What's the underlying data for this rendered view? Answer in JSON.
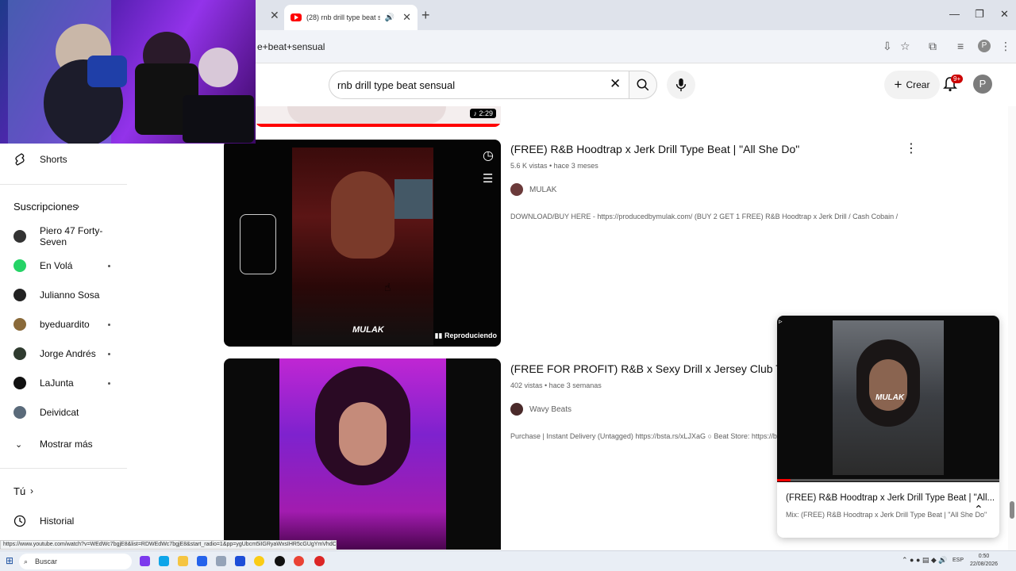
{
  "browser": {
    "active_tab_title": "(28) rnb drill type beat sensual - YouTube",
    "url": "e+beat+sensual",
    "status_url": "https://www.youtube.com/watch?v=WEdWc7bgjE8&list=RDWEdWc7bgjE8&start_radio=1&pp=ygUbcm5iIGRyaWxsIHR5cGUgYmVhdCBzZW5zdWFs",
    "profile_initial": "P"
  },
  "header": {
    "search_value": "rnb drill type beat sensual",
    "create_label": "Crear",
    "notifications_badge": "9+",
    "avatar_initial": "P"
  },
  "sidebar": {
    "shorts_label": "Shorts",
    "subscriptions_heading": "Suscripciones",
    "subscriptions": [
      {
        "label": "Piero 47 Forty-Seven",
        "color": "#333333",
        "dot": false
      },
      {
        "label": "En Volá",
        "color": "#25d366",
        "dot": true
      },
      {
        "label": "Julianno Sosa",
        "color": "#222222",
        "dot": false
      },
      {
        "label": "byeduardito",
        "color": "#8a6a3a",
        "dot": true
      },
      {
        "label": "Jorge Andrés",
        "color": "#2f3b2f",
        "dot": true
      },
      {
        "label": "LaJunta",
        "color": "#111111",
        "dot": true
      },
      {
        "label": "Deividcat",
        "color": "#5a6a7a",
        "dot": false
      }
    ],
    "show_more_label": "Mostrar más",
    "you_heading": "Tú",
    "history_label": "Historial"
  },
  "results": {
    "prev_duration": "2:29",
    "items": [
      {
        "title": "(FREE) R&B Hoodtrap x Jerk Drill Type Beat | \"All She Do\"",
        "meta": "5.6 K vistas • hace 3 meses",
        "channel": "MULAK",
        "description": "DOWNLOAD/BUY HERE - https://producedbymulak.com/ (BUY 2 GET 1 FREE) R&B Hoodtrap x Jerk Drill / Cash Cobain / Central ...",
        "thumb_watermark": "MULAK",
        "thumb_status": "Reproduciendo"
      },
      {
        "title": "(FREE FOR PROFIT) R&B x Sexy Drill x Jersey Club Type Beat",
        "meta": "402 vistas • hace 3 semanas",
        "channel": "Wavy Beats",
        "description": "Purchase | Instant Delivery (Untagged) https://bsta.rs/xLJXaG ○ Beat Store: https://beatstars"
      }
    ]
  },
  "miniplayer": {
    "title": "(FREE) R&B Hoodtrap x Jerk Drill Type Beat | \"All...",
    "subtitle": "Mix: (FREE) R&B Hoodtrap x Jerk Drill Type Beat | \"All She Do\"",
    "watermark": "MULAK",
    "progress": 0.06
  },
  "taskbar": {
    "search_placeholder": "Buscar",
    "time": "0:50",
    "date": "22/08/2026",
    "lang": "ESP"
  }
}
